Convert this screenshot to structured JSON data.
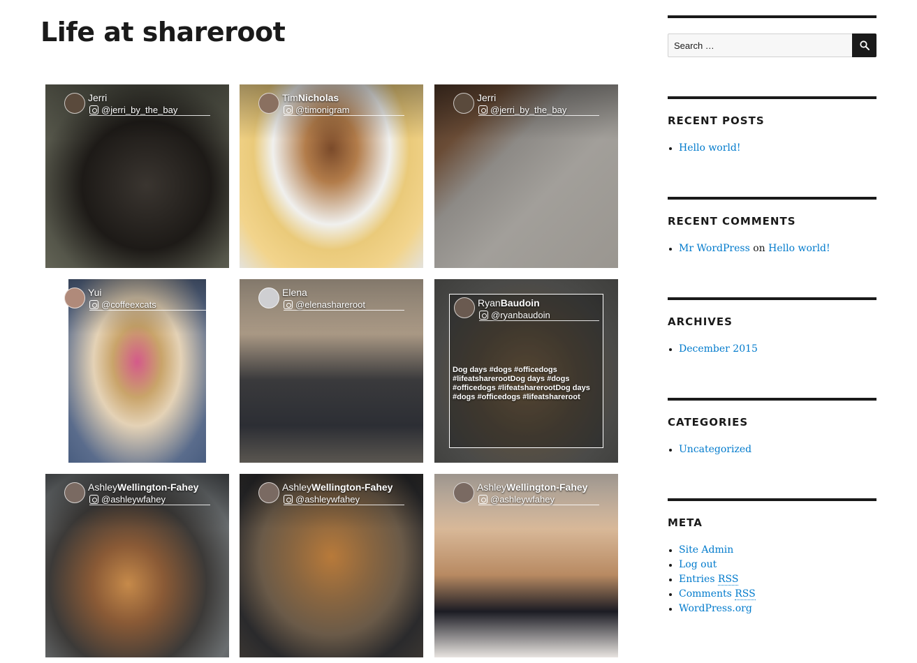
{
  "page": {
    "title": "Life at shareroot"
  },
  "gallery": [
    {
      "first": "Jerri",
      "last": "",
      "handle": "@jerri_by_the_bay"
    },
    {
      "first": "Tim",
      "last": "Nicholas",
      "handle": "@timonigram"
    },
    {
      "first": "Jerri",
      "last": "",
      "handle": "@jerri_by_the_bay"
    },
    {
      "first": "Yui",
      "last": "",
      "handle": "@coffeexcats"
    },
    {
      "first": "Elena",
      "last": "",
      "handle": "@elenashareroot"
    },
    {
      "first": "Ryan",
      "last": "Baudoin",
      "handle": "@ryanbaudoin",
      "caption": "Dog days #dogs #officedogs #lifeatsharerootDog days #dogs #officedogs #lifeatsharerootDog days #dogs #officedogs #lifeatshareroot"
    },
    {
      "first": "Ashley",
      "last": "Wellington-Fahey",
      "handle": "@ashleywfahey"
    },
    {
      "first": "Ashley",
      "last": "Wellington-Fahey",
      "handle": "@ashleywfahey"
    },
    {
      "first": "Ashley",
      "last": "Wellington-Fahey",
      "handle": "@ashleywfahey"
    }
  ],
  "sidebar": {
    "search": {
      "placeholder": "Search …"
    },
    "recent_posts": {
      "title": "RECENT POSTS",
      "items": [
        "Hello world!"
      ]
    },
    "recent_comments": {
      "title": "RECENT COMMENTS",
      "author": "Mr WordPress",
      "on": "on",
      "post": "Hello world!"
    },
    "archives": {
      "title": "ARCHIVES",
      "items": [
        "December 2015"
      ]
    },
    "categories": {
      "title": "CATEGORIES",
      "items": [
        "Uncategorized"
      ]
    },
    "meta": {
      "title": "META",
      "site_admin": "Site Admin",
      "log_out": "Log out",
      "entries": "Entries",
      "comments": "Comments",
      "rss": "RSS",
      "wordpress_org": "WordPress.org"
    }
  },
  "colors": {
    "link": "#007acc",
    "text": "#1a1a1a",
    "rule": "#1a1a1a"
  }
}
